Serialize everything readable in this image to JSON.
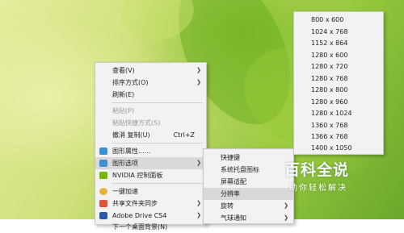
{
  "context_menu": {
    "items": [
      {
        "label": "查看(V)"
      },
      {
        "label": "排序方式(O)"
      },
      {
        "label": "刷新(E)"
      },
      {
        "label": "粘贴(P)"
      },
      {
        "label": "粘贴快捷方式(S)"
      },
      {
        "label": "撤消 复制(U)",
        "shortcut": "Ctrl+Z"
      },
      {
        "label": "图形属性......"
      },
      {
        "label": "图形选项"
      },
      {
        "label": "NVIDIA 控制面板"
      },
      {
        "label": "一键加速"
      },
      {
        "label": "共享文件夹同步"
      },
      {
        "label": "Adobe Drive CS4"
      },
      {
        "label": "下一个桌面背景(N)"
      }
    ]
  },
  "graphics_submenu": {
    "items": [
      {
        "label": "快捷键"
      },
      {
        "label": "系统托盘图标"
      },
      {
        "label": "屏幕适配"
      },
      {
        "label": "分辨率"
      },
      {
        "label": "旋转"
      },
      {
        "label": "气球通知"
      }
    ]
  },
  "resolution_submenu": {
    "items": [
      "800 x 600",
      "1024 x 768",
      "1152 x 864",
      "1280 x 600",
      "1280 x 720",
      "1280 x 768",
      "1280 x 800",
      "1280 x 960",
      "1280 x 1024",
      "1360 x 768",
      "1366 x 768",
      "1400 x 1050"
    ]
  },
  "watermark": {
    "title": "百科全说",
    "subtitle": "助你轻松解决"
  },
  "colors": {
    "menu_bg": "#f2f2f2",
    "highlight": "#d9d9d9",
    "disabled": "#9a9a9a"
  }
}
